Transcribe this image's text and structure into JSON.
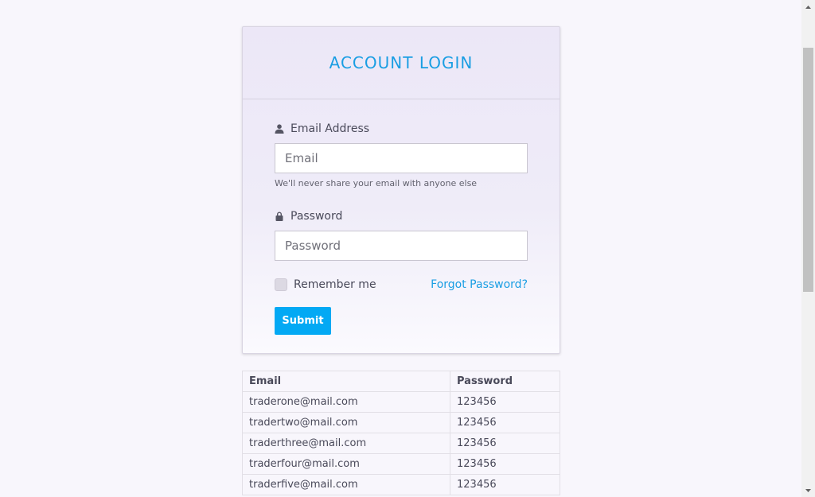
{
  "login": {
    "title": "ACCOUNT LOGIN",
    "email_label": "Email Address",
    "email_placeholder": "Email",
    "email_help": "We'll never share your email with anyone else",
    "password_label": "Password",
    "password_placeholder": "Password",
    "remember_label": "Remember me",
    "forgot_label": "Forgot Password?",
    "submit_label": "Submit"
  },
  "credentials": {
    "headers": [
      "Email",
      "Password"
    ],
    "rows": [
      [
        "traderone@mail.com",
        "123456"
      ],
      [
        "tradertwo@mail.com",
        "123456"
      ],
      [
        "traderthree@mail.com",
        "123456"
      ],
      [
        "traderfour@mail.com",
        "123456"
      ],
      [
        "traderfive@mail.com",
        "123456"
      ]
    ]
  },
  "icons": {
    "email": "user-icon",
    "password": "lock-icon"
  },
  "colors": {
    "accent": "#1a9ee3",
    "button": "#03a9f4"
  }
}
